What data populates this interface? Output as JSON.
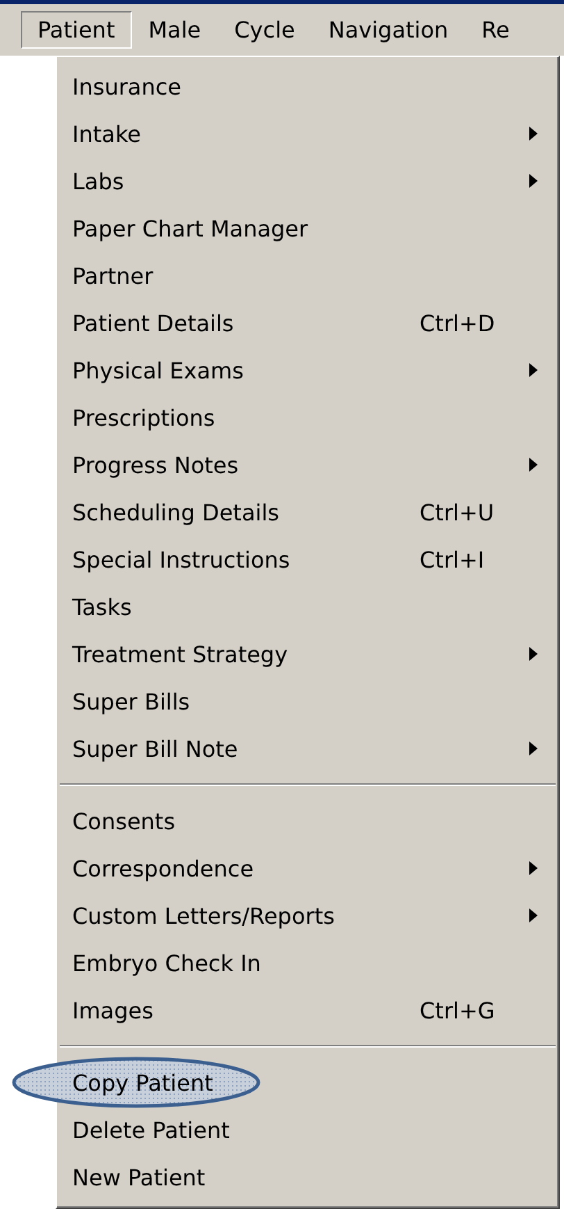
{
  "menu_bar": [
    {
      "label": "Patient",
      "selected": true
    },
    {
      "label": "Male",
      "selected": false
    },
    {
      "label": "Cycle",
      "selected": false
    },
    {
      "label": "Navigation",
      "selected": false
    },
    {
      "label": "Re",
      "selected": false
    }
  ],
  "menu": {
    "sections": [
      {
        "items": [
          {
            "label": "Insurance",
            "submenu": false,
            "circled": false
          },
          {
            "label": "Intake",
            "submenu": true,
            "circled": false
          },
          {
            "label": "Labs",
            "submenu": true,
            "circled": false
          },
          {
            "label": "Paper Chart Manager",
            "submenu": false,
            "circled": false
          },
          {
            "label": "Partner",
            "submenu": false,
            "circled": false
          },
          {
            "label": "Patient Details",
            "shortcut": "Ctrl+D",
            "submenu": false,
            "circled": false
          },
          {
            "label": "Physical Exams",
            "submenu": true,
            "circled": false
          },
          {
            "label": "Prescriptions",
            "submenu": false,
            "circled": false
          },
          {
            "label": "Progress Notes",
            "submenu": true,
            "circled": false
          },
          {
            "label": "Scheduling Details",
            "shortcut": "Ctrl+U",
            "submenu": false,
            "circled": false
          },
          {
            "label": "Special Instructions",
            "shortcut": "Ctrl+I",
            "submenu": false,
            "circled": false
          },
          {
            "label": "Tasks",
            "submenu": false,
            "circled": false
          },
          {
            "label": "Treatment Strategy",
            "submenu": true,
            "circled": false
          },
          {
            "label": "Super Bills",
            "submenu": false,
            "circled": false
          },
          {
            "label": "Super Bill Note",
            "submenu": true,
            "circled": false
          }
        ]
      },
      {
        "items": [
          {
            "label": "Consents",
            "submenu": false,
            "circled": false
          },
          {
            "label": "Correspondence",
            "submenu": true,
            "circled": false
          },
          {
            "label": "Custom Letters/Reports",
            "submenu": true,
            "circled": false
          },
          {
            "label": "Embryo Check In",
            "submenu": false,
            "circled": false
          },
          {
            "label": "Images",
            "shortcut": "Ctrl+G",
            "submenu": false,
            "circled": false
          }
        ]
      },
      {
        "items": [
          {
            "label": "Copy Patient",
            "submenu": false,
            "circled": true
          },
          {
            "label": "Delete Patient",
            "submenu": false,
            "circled": false
          },
          {
            "label": "New Patient",
            "submenu": false,
            "circled": false
          }
        ]
      }
    ]
  }
}
